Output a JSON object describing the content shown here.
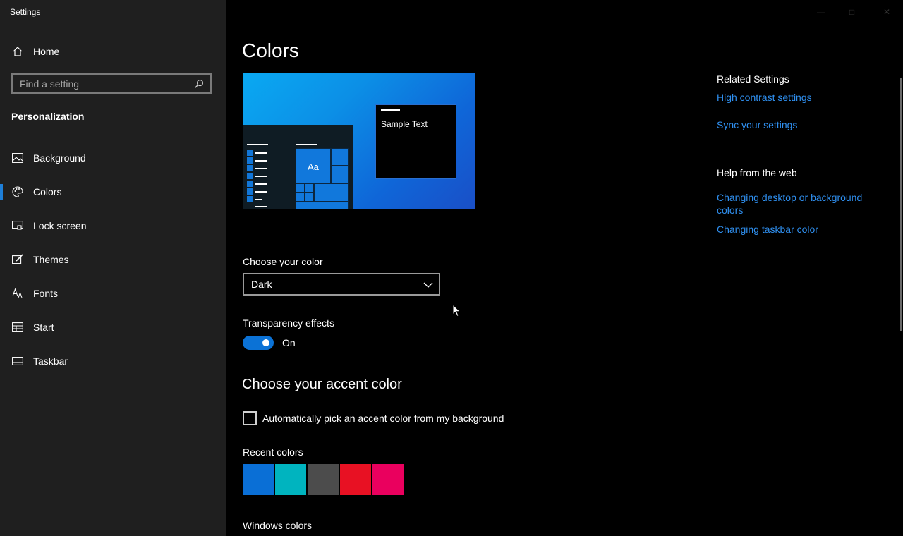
{
  "window": {
    "title": "Settings"
  },
  "sidebar": {
    "home_label": "Home",
    "search_placeholder": "Find a setting",
    "section": "Personalization",
    "items": [
      {
        "label": "Background",
        "icon": "image-icon"
      },
      {
        "label": "Colors",
        "icon": "palette-icon",
        "active": true
      },
      {
        "label": "Lock screen",
        "icon": "lock-screen-icon"
      },
      {
        "label": "Themes",
        "icon": "brush-icon"
      },
      {
        "label": "Fonts",
        "icon": "font-icon"
      },
      {
        "label": "Start",
        "icon": "start-icon"
      },
      {
        "label": "Taskbar",
        "icon": "taskbar-icon"
      }
    ]
  },
  "main": {
    "title": "Colors",
    "preview": {
      "sample_text": "Sample Text",
      "tile_text": "Aa"
    },
    "choose_color": {
      "label": "Choose your color",
      "value": "Dark"
    },
    "transparency": {
      "label": "Transparency effects",
      "state": "On"
    },
    "accent": {
      "heading": "Choose your accent color",
      "auto_pick_label": "Automatically pick an accent color from my background",
      "recent_label": "Recent colors",
      "recent_colors": [
        "#0a6fd6",
        "#00b4bf",
        "#4c4c4c",
        "#e81123",
        "#ea005e"
      ],
      "windows_colors_label": "Windows colors"
    }
  },
  "related": {
    "heading": "Related Settings",
    "links": [
      "High contrast settings",
      "Sync your settings"
    ]
  },
  "help": {
    "heading": "Help from the web",
    "links": [
      "Changing desktop or background colors",
      "Changing taskbar color"
    ]
  },
  "colors": {
    "accent": "#1e7fd8",
    "link": "#2f8fef",
    "sidebar_bg": "#1f1f1f",
    "main_bg": "#000000"
  }
}
